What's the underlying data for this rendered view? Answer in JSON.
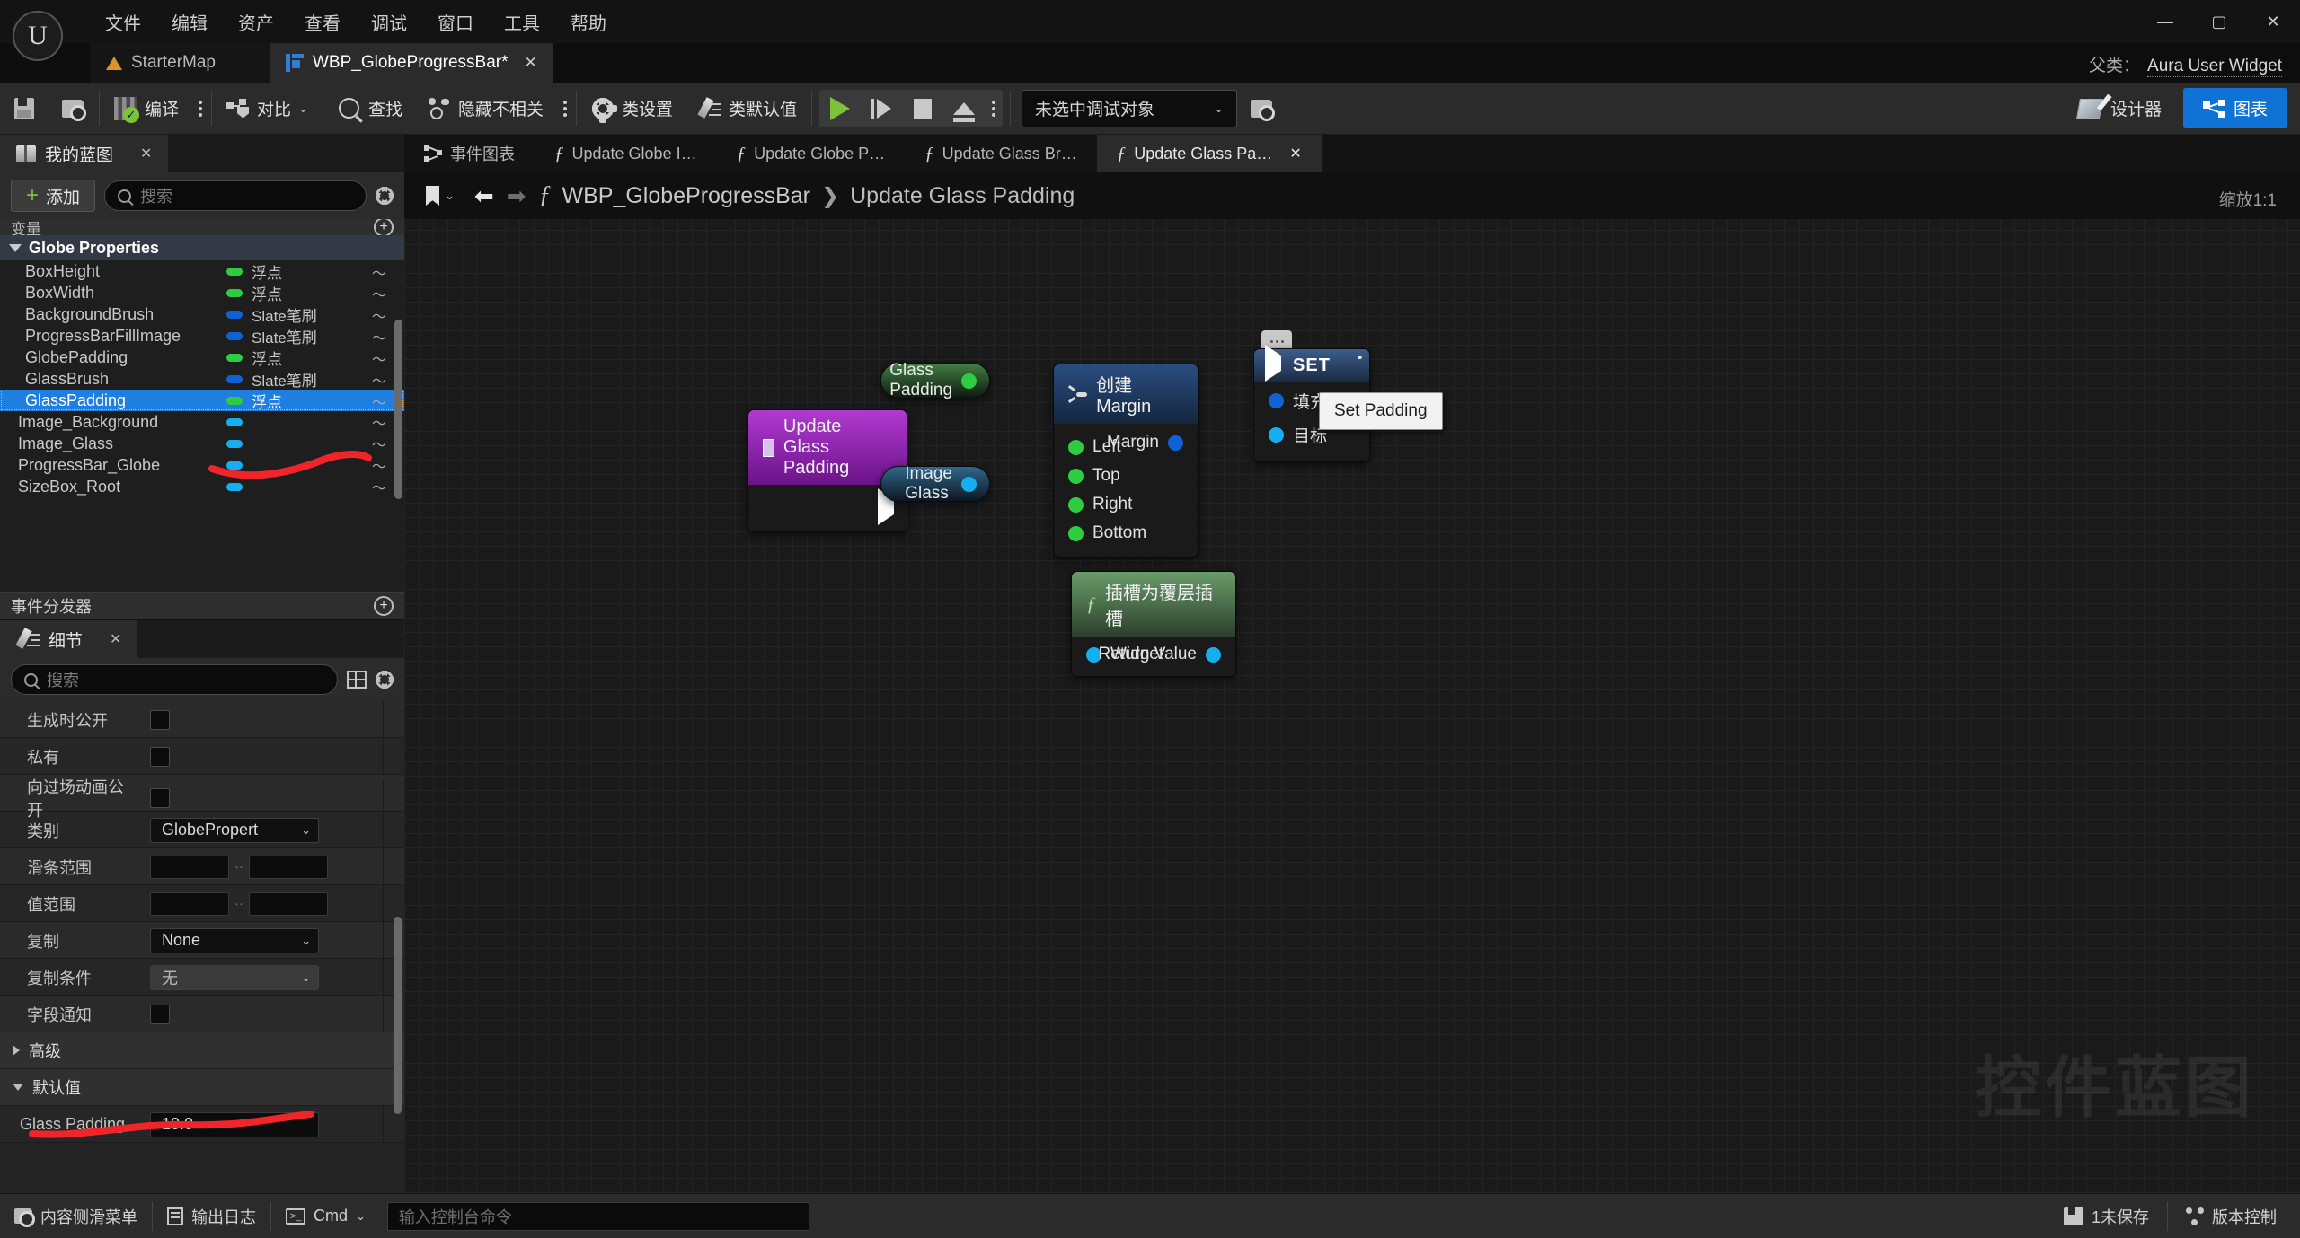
{
  "window": {
    "menu": [
      "文件",
      "编辑",
      "资产",
      "查看",
      "调试",
      "窗口",
      "工具",
      "帮助"
    ],
    "minimize": "—",
    "maximize": "▢",
    "close": "✕"
  },
  "asset_tabs": {
    "starter_map": "StarterMap",
    "active_tab": "WBP_GlobeProgressBar*",
    "close_glyph": "✕"
  },
  "parent_class": {
    "label": "父类：",
    "value": "Aura User Widget"
  },
  "toolbar": {
    "compile": "编译",
    "diff": "对比",
    "find": "查找",
    "hide_unrelated": "隐藏不相关",
    "class_settings": "类设置",
    "class_defaults": "类默认值",
    "debug_object": "未选中调试对象",
    "designer": "设计器",
    "graph": "图表"
  },
  "my_blueprint": {
    "title": "我的蓝图",
    "close_glyph": "✕",
    "add_label": "添加",
    "search_placeholder": "搜索",
    "partial_section": "变量",
    "category": "Globe Properties",
    "variables": [
      {
        "name": "BoxHeight",
        "type": "浮点",
        "color": "#2ecc40"
      },
      {
        "name": "BoxWidth",
        "type": "浮点",
        "color": "#2ecc40"
      },
      {
        "name": "BackgroundBrush",
        "type": "Slate笔刷",
        "color": "#0f62d6"
      },
      {
        "name": "ProgressBarFillImage",
        "type": "Slate笔刷",
        "color": "#0f62d6"
      },
      {
        "name": "GlobePadding",
        "type": "浮点",
        "color": "#2ecc40"
      },
      {
        "name": "GlassBrush",
        "type": "Slate笔刷",
        "color": "#0f62d6"
      },
      {
        "name": "GlassPadding",
        "type": "浮点",
        "color": "#2ecc40",
        "selected": true
      },
      {
        "name": "Image_Background",
        "type": "",
        "color": "#15aef0"
      },
      {
        "name": "Image_Glass",
        "type": "",
        "color": "#15aef0"
      },
      {
        "name": "ProgressBar_Globe",
        "type": "",
        "color": "#15aef0"
      },
      {
        "name": "SizeBox_Root",
        "type": "",
        "color": "#15aef0"
      }
    ],
    "event_dispatchers": "事件分发器",
    "eye_glyph": "〜"
  },
  "details": {
    "title": "细节",
    "close_glyph": "✕",
    "search_placeholder": "搜索",
    "rows": [
      {
        "label": "生成时公开",
        "kind": "checkbox"
      },
      {
        "label": "私有",
        "kind": "checkbox"
      },
      {
        "label": "向过场动画公开",
        "kind": "checkbox"
      },
      {
        "label": "类别",
        "kind": "combo",
        "value": "GlobePropert"
      },
      {
        "label": "滑条范围",
        "kind": "range"
      },
      {
        "label": "值范围",
        "kind": "range"
      },
      {
        "label": "复制",
        "kind": "combo",
        "value": "None"
      },
      {
        "label": "复制条件",
        "kind": "combo-gray",
        "value": "无"
      },
      {
        "label": "字段通知",
        "kind": "checkbox"
      }
    ],
    "advanced_section": "高级",
    "defaults_section": "默认值",
    "default_field": {
      "label": "Glass Padding",
      "value": "10.0"
    },
    "range_sep": "··",
    "chevron": "⌄"
  },
  "graph_tabs": [
    {
      "label": "事件图表",
      "icon": "event-graph-icon",
      "active": false
    },
    {
      "label": "Update Globe I…",
      "icon": "function-icon",
      "active": false
    },
    {
      "label": "Update Globe P…",
      "icon": "function-icon",
      "active": false
    },
    {
      "label": "Update Glass Br…",
      "icon": "function-icon",
      "active": false
    },
    {
      "label": "Update Glass Pa…",
      "icon": "function-icon",
      "active": true
    }
  ],
  "breadcrumb": {
    "root": "WBP_GlobeProgressBar",
    "separator": "❯",
    "current": "Update Glass Padding",
    "fx": "ƒ",
    "back_glyph": "⬅",
    "forward_glyph": "➡",
    "chevron": "⌄"
  },
  "graph": {
    "zoom": "缩放1:1",
    "watermark": "控件蓝图",
    "nodes": {
      "entry": {
        "title": "Update Glass Padding"
      },
      "glass_padding_var": {
        "label": "Glass Padding"
      },
      "image_glass_var": {
        "label": "Image Glass"
      },
      "make_margin": {
        "title": "创建Margin",
        "inputs": [
          "Left",
          "Top",
          "Right",
          "Bottom"
        ],
        "output": "Margin"
      },
      "slot_as_overlay": {
        "title": "插槽为覆层插槽",
        "input": "Widget",
        "output": "Return Value"
      },
      "set_node": {
        "title": "SET",
        "inputs": [
          "填充",
          "目标"
        ]
      },
      "tooltip": "Set Padding"
    }
  },
  "statusbar": {
    "content_drawer": "内容侧滑菜单",
    "output_log": "输出日志",
    "cmd_label": "Cmd",
    "cmd_chevron": "⌄",
    "cmd_placeholder": "输入控制台命令",
    "unsaved": "1未保存",
    "source_control": "版本控制"
  }
}
